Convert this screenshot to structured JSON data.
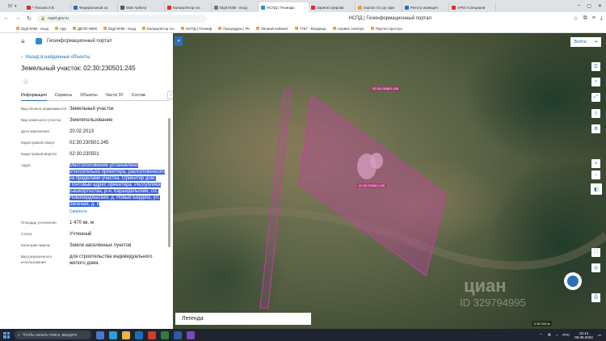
{
  "browser": {
    "tabs": [
      {
        "label": "* Письмо в В",
        "color": "#d93025"
      },
      {
        "label": "Федеральный за",
        "color": "#2c6fb6"
      },
      {
        "label": "Мой Арбитр",
        "color": "#555555"
      },
      {
        "label": "Калькулятор гос",
        "color": "#d93025"
      },
      {
        "label": "Digit МЭВ - вход",
        "color": "#777777"
      },
      {
        "label": "НСПД | Геоинфо",
        "color": "#2d8ccf",
        "active": true
      },
      {
        "label": "Зарегистрирова",
        "color": "#d93025"
      },
      {
        "label": "портал гос ру офи",
        "color": "#e8a33c"
      },
      {
        "label": "Реестр извещен",
        "color": "#2c6fb6"
      },
      {
        "label": "АРМ «Специали",
        "color": "#d93025"
      }
    ],
    "tab_count": "10",
    "url": "nspd.gov.ru",
    "page_title": "НСПД | Геоинформационный портал",
    "bookmarks": [
      "Digit МЭВ - вход",
      "App",
      "ДЕЛО-WEB",
      "Digit МЭВ - вход",
      "Калькулятор гос",
      "НСПД | Геоинф",
      "Процедуры | Ре",
      "Личный кабинет",
      "7767 - Входящи",
      "Сервис электро",
      "Портал простро"
    ]
  },
  "panel": {
    "portal_name": "Геоинформационный портал",
    "back_link": "Назад в найденные объекты",
    "title": "Земельный участок: 02:30:230501:245",
    "tabs": [
      "Информация",
      "Сервисы",
      "Объекты",
      "Части ЗУ",
      "Состав"
    ],
    "attributes": [
      {
        "label": "Вид объекта недвижимости",
        "value": "Земельный участок"
      },
      {
        "label": "Вид земельного участка",
        "value": "Землепользование"
      },
      {
        "label": "Дата присвоения",
        "value": "20.02.2013"
      },
      {
        "label": "Кадастровый номер",
        "value": "02:30:230501:245"
      },
      {
        "label": "Кадастровый квартал",
        "value": "02:30:230501"
      },
      {
        "label": "Адрес",
        "value": "Местоположение установлено относительно ориентира, расположенного за пределами участка. Ориентир дом. Почтовый адрес ориентира: Республика Башкортостан, р-н. Караидельский, с/с. Новобердяшский, д. Новый Бердяш, ул. Зеленая, д. 8"
      },
      {
        "label": "Площадь уточненная",
        "value": "1 470 кв. м"
      },
      {
        "label": "Статус",
        "value": "Учтенный"
      },
      {
        "label": "Категория земель",
        "value": "Земли населенных пунктов"
      },
      {
        "label": "Вид разрешенного использования",
        "value": "для строительства индивидуального жилого дома"
      }
    ],
    "collapse_link": "Свернуть"
  },
  "map": {
    "login": "Войти",
    "legend": "Легенда",
    "parcel_label": "02:30:230501:245",
    "neighbor_label": "02:30:230501:245",
    "watermark_brand": "циан",
    "watermark_id": "ID 329794995",
    "scale": "0 50 100 м",
    "parcel_color": "#c040a0"
  },
  "taskbar": {
    "search_placeholder": "Чтобы начать поиск, введите",
    "lang": "РУС",
    "time": "15:14",
    "date": "06.05.2024"
  }
}
